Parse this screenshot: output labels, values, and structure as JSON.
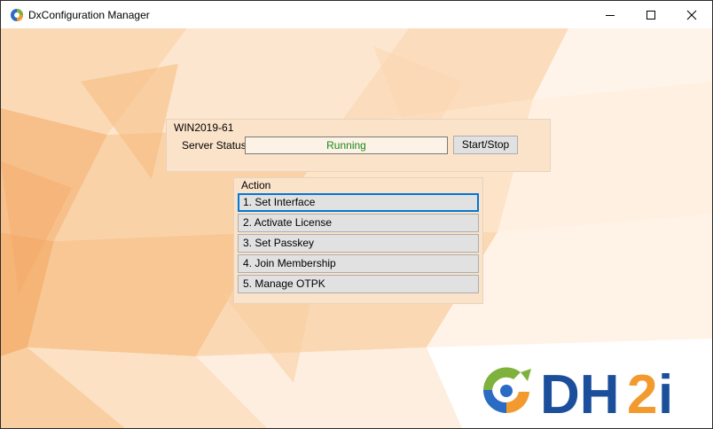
{
  "window": {
    "title": "DxConfiguration Manager",
    "icon": "dxconfig-app-icon",
    "controls": [
      "minimize-icon",
      "maximize-icon",
      "close-icon"
    ]
  },
  "server_group": {
    "title": "WIN2019-61",
    "status_label": "Server Status:",
    "status_value": "Running",
    "status_color": "#1a8a1a",
    "start_stop_label": "Start/Stop"
  },
  "action_group": {
    "title": "Action",
    "buttons": [
      {
        "label": "1. Set Interface",
        "focused": true
      },
      {
        "label": "2. Activate License",
        "focused": false
      },
      {
        "label": "3. Set Passkey",
        "focused": false
      },
      {
        "label": "4. Join Membership",
        "focused": false
      },
      {
        "label": "5. Manage OTPK",
        "focused": false
      }
    ]
  },
  "logo": {
    "text": "DH2i",
    "brand_blue": "#1b4f9c",
    "brand_orange": "#f29a2e",
    "brand_green": "#7fb13d"
  }
}
